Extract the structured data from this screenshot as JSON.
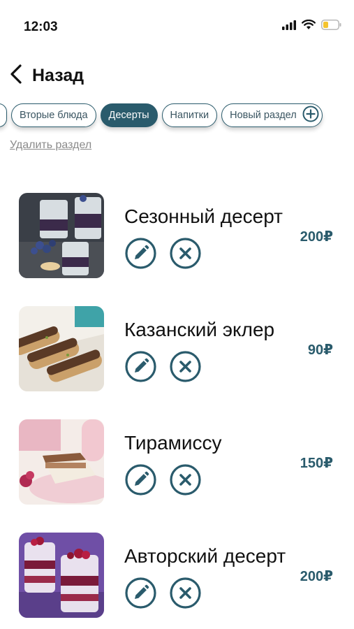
{
  "status": {
    "time": "12:03",
    "icons": [
      "cellular-icon",
      "wifi-icon",
      "battery-low-icon"
    ]
  },
  "header": {
    "back_label": "Назад"
  },
  "tabs": [
    {
      "label": "Вторые блюда",
      "active": false
    },
    {
      "label": "Десерты",
      "active": true
    },
    {
      "label": "Напитки",
      "active": false
    },
    {
      "label": "Новый раздел",
      "active": false
    }
  ],
  "delete_section_label": "Удалить раздел",
  "items": [
    {
      "name": "Сезонный десерт",
      "price": "200₽"
    },
    {
      "name": "Казанский эклер",
      "price": "90₽"
    },
    {
      "name": "Тирамиссу",
      "price": "150₽"
    },
    {
      "name": "Авторский десерт",
      "price": "200₽"
    }
  ],
  "colors": {
    "accent": "#2a5b6c",
    "muted_text": "#8a8a8a"
  }
}
